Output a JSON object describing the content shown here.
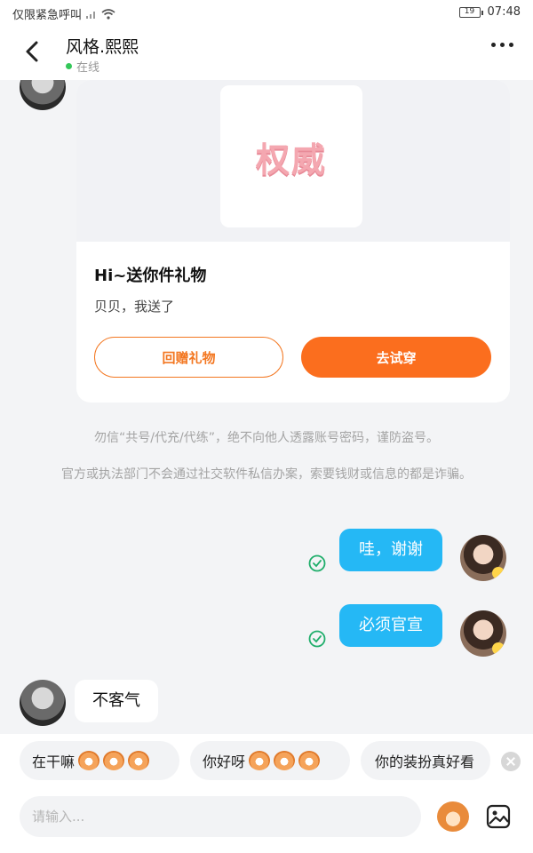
{
  "status_bar": {
    "carrier": "仅限紧急呼叫",
    "battery": "19",
    "time": "07:48"
  },
  "header": {
    "name": "风格.熙熙",
    "status": "在线"
  },
  "gift_card": {
    "image_text": "权威",
    "title": "Hi~送你件礼物",
    "desc": "贝贝，我送了",
    "return_gift_label": "回赠礼物",
    "try_on_label": "去试穿"
  },
  "notices": [
    "勿信“共号/代充/代练”，绝不向他人透露账号密码，谨防盗号。",
    "官方或执法部门不会通过社交软件私信办案，索要钱财或信息的都是诈骗。"
  ],
  "messages": [
    {
      "from": "me",
      "text": "哇，谢谢"
    },
    {
      "from": "me",
      "text": "必须官宣"
    },
    {
      "from": "other",
      "text": "不客气"
    }
  ],
  "quick_replies": [
    {
      "text": "在干嘛"
    },
    {
      "text": "你好呀"
    },
    {
      "text": "你的装扮真好看"
    }
  ],
  "input": {
    "placeholder": "请输入..."
  },
  "colors": {
    "accent_orange": "#fb6e1e",
    "bubble_blue": "#25b8f5",
    "online_green": "#34c759"
  }
}
